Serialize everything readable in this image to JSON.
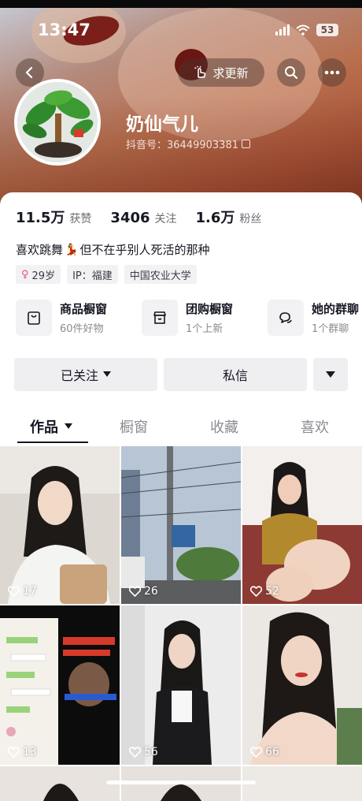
{
  "status_bar": {
    "time": "13:47",
    "battery": "53"
  },
  "header": {
    "update_button": "求更新",
    "nickname": "奶仙气儿",
    "douyin_id": "抖音号：36449903381"
  },
  "stats": [
    {
      "num": "11.5万",
      "label": "获赞"
    },
    {
      "num": "3406",
      "label": "关注"
    },
    {
      "num": "1.6万",
      "label": "粉丝"
    }
  ],
  "bio": {
    "part1": "喜欢跳舞",
    "emoji": "💃",
    "part2": "但不在乎别人死活的那种"
  },
  "tags": {
    "age": "29岁",
    "ip": "IP：福建",
    "school": "中国农业大学"
  },
  "features": [
    {
      "title": "商品橱窗",
      "sub": "60件好物",
      "icon": "shop-window-icon"
    },
    {
      "title": "团购橱窗",
      "sub": "1个上新",
      "icon": "group-buy-icon"
    },
    {
      "title": "她的群聊",
      "sub": "1个群聊",
      "icon": "group-chat-icon"
    }
  ],
  "actions": {
    "follow": "已关注",
    "message": "私信"
  },
  "tabs": [
    "作品",
    "橱窗",
    "收藏",
    "喜欢"
  ],
  "videos": [
    {
      "likes": "17"
    },
    {
      "likes": "26"
    },
    {
      "likes": "52"
    },
    {
      "likes": "13"
    },
    {
      "likes": "56"
    },
    {
      "likes": "66"
    }
  ],
  "colors": {
    "text_primary": "#161823",
    "text_secondary": "#6c6d73",
    "accent_female": "#e5518e",
    "button_bg": "#efeff2"
  }
}
